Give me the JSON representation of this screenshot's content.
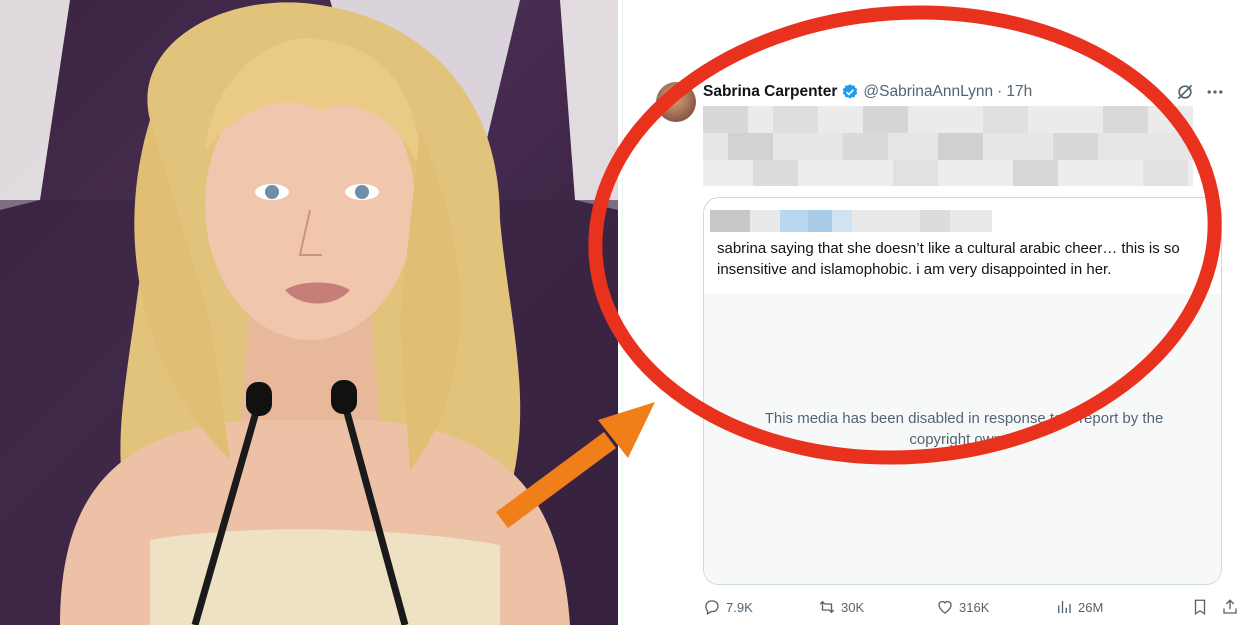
{
  "photo": {
    "description_icon": "person-at-microphones-photo"
  },
  "tweet": {
    "display_name": "Sabrina Carpenter",
    "handle": "@SabrinaAnnLynn",
    "separator": "·",
    "time": "17h",
    "verified_icon": "verified-badge-icon",
    "quote": {
      "text": "sabrina saying that she doesn’t like a cultural arabic cheer… this is so insensitive and islamophobic. i am very disappointed in her.",
      "media_notice": "This media has been disabled in response to a report by the copyright owner."
    },
    "actions": {
      "replies": "7.9K",
      "reposts": "30K",
      "likes": "316K",
      "views": "26M"
    }
  },
  "colors": {
    "circle": "#e8321e",
    "arrow": "#f07f1a",
    "verified": "#1d9bf0",
    "secondary_text": "#536471"
  }
}
